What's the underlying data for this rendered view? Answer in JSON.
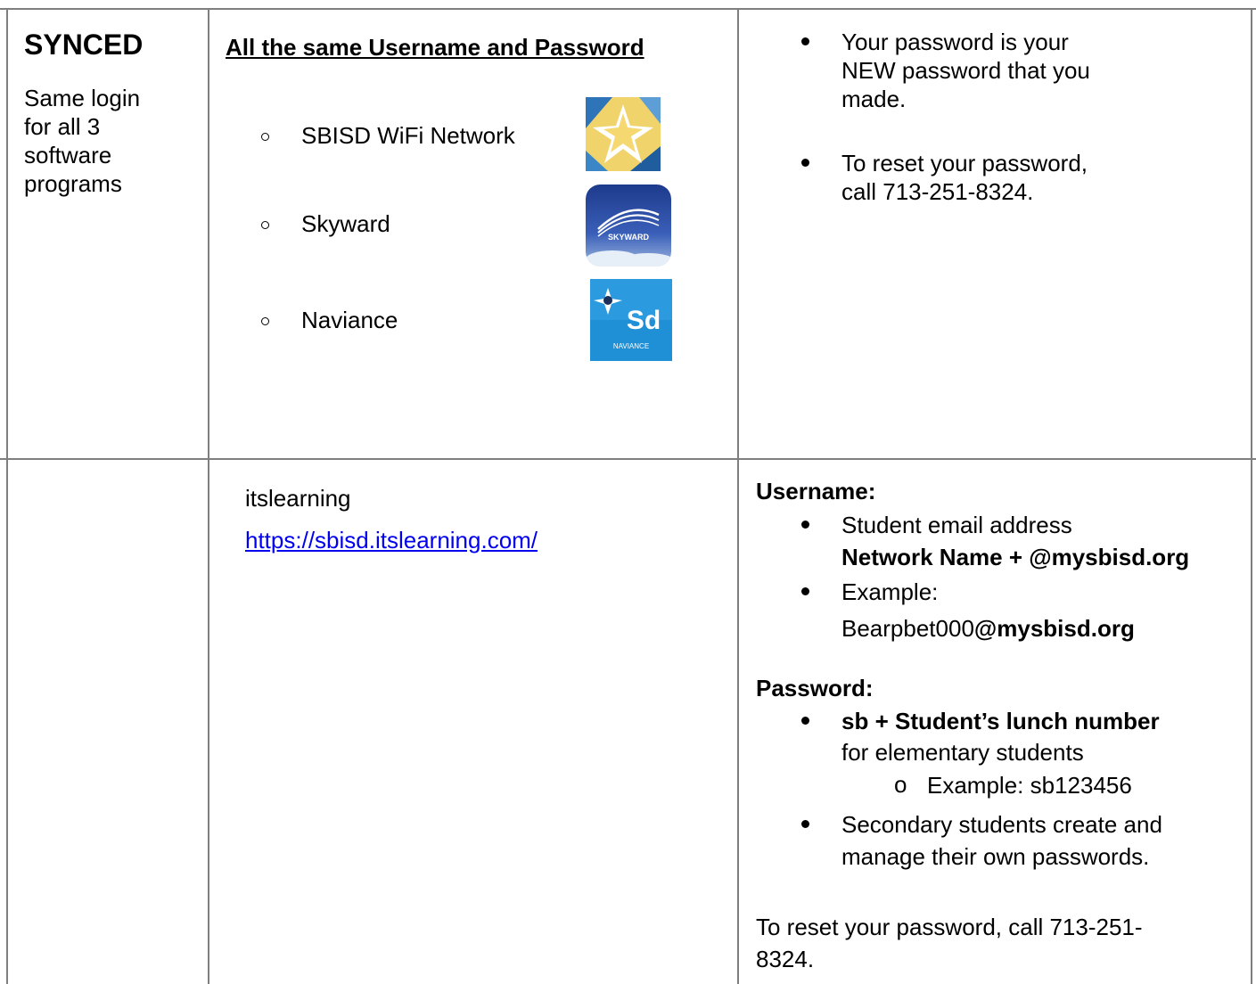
{
  "row1": {
    "col1": {
      "title": "SYNCED",
      "description_lines": [
        "Same login",
        "for all 3",
        "software",
        "programs"
      ]
    },
    "col2": {
      "heading": "All the same Username and Password",
      "items": [
        {
          "label": "SBISD WiFi Network",
          "icon": "sbisd-star-logo"
        },
        {
          "label": "Skyward",
          "icon": "skyward-logo"
        },
        {
          "label": "Naviance",
          "icon": "naviance-logo"
        }
      ],
      "naviance_logo_text": "Sd",
      "naviance_logo_caption": "NAVIANCE",
      "skyward_logo_text": "SKYWARD"
    },
    "col3": {
      "bullets": [
        {
          "lines": [
            "Your password is your",
            "NEW password that you",
            "made."
          ]
        },
        {
          "lines": [
            "To reset your password,",
            "call 713-251-8324."
          ]
        }
      ]
    }
  },
  "row2": {
    "col2": {
      "name": "itslearning",
      "url": "https://sbisd.itslearning.com/"
    },
    "col3": {
      "username_label": "Username:",
      "username_b1_line1": "Student email address",
      "username_b1_line2": "Network Name + @mysbisd.org",
      "username_b2_line1": "Example:",
      "username_b2_prefix": "Bearpbet000",
      "username_b2_suffix": "@mysbisd.org",
      "password_label": "Password:",
      "password_b1_bold": "sb + Student’s lunch number",
      "password_b1_rest": "for elementary students",
      "password_sub_marker": "o",
      "password_sub": "Example: sb123456",
      "password_b2_line1": "Secondary students create and",
      "password_b2_line2": "manage their own passwords.",
      "reset_line1": "To reset your password, call 713-251-",
      "reset_line2": "8324."
    }
  }
}
